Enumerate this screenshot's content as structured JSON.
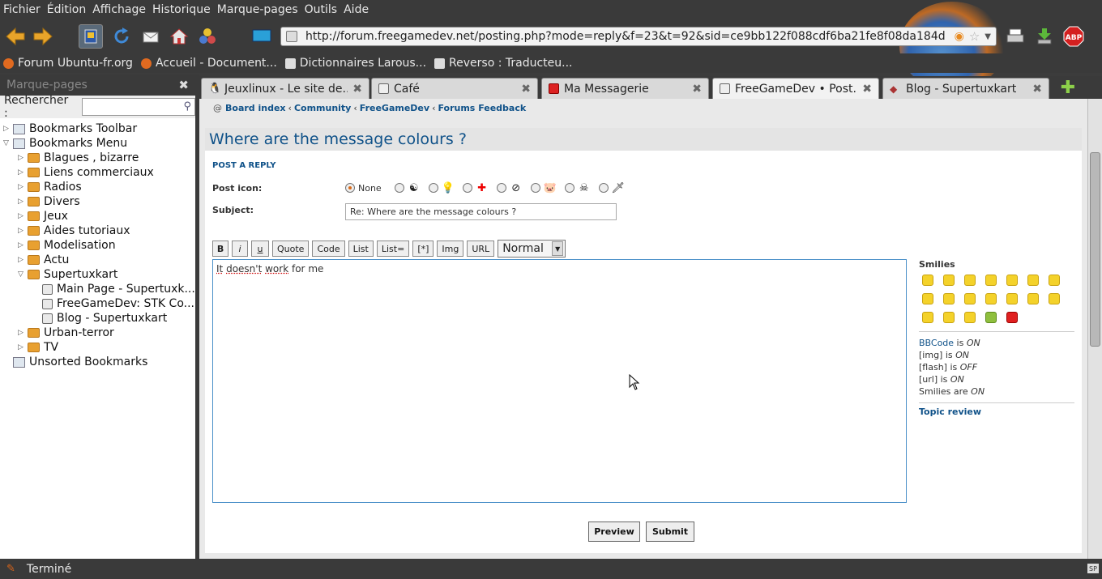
{
  "menubar": {
    "items": [
      "Fichier",
      "Édition",
      "Affichage",
      "Historique",
      "Marque-pages",
      "Outils",
      "Aide"
    ]
  },
  "navbar": {
    "url": "http://forum.freegamedev.net/posting.php?mode=reply&f=23&t=92&sid=ce9bb122f088cdf6ba21fe8f08da184d"
  },
  "bookmarks_bar": {
    "items": [
      "Forum Ubuntu-fr.org",
      "Accueil - Document...",
      "Dictionnaires Larous...",
      "Reverso : Traducteu..."
    ]
  },
  "sidebar": {
    "title": "Marque-pages",
    "search_label": "Rechercher :",
    "tree": [
      {
        "label": "Bookmarks Toolbar",
        "type": "special",
        "twisty": "▷",
        "indent": 0
      },
      {
        "label": "Bookmarks Menu",
        "type": "special",
        "twisty": "▽",
        "indent": 0
      },
      {
        "label": "Blagues , bizarre",
        "type": "folder",
        "twisty": "▷",
        "indent": 1
      },
      {
        "label": "Liens commerciaux",
        "type": "folder",
        "twisty": "▷",
        "indent": 1
      },
      {
        "label": "Radios",
        "type": "folder",
        "twisty": "▷",
        "indent": 1
      },
      {
        "label": "Divers",
        "type": "folder",
        "twisty": "▷",
        "indent": 1
      },
      {
        "label": "Jeux",
        "type": "folder",
        "twisty": "▷",
        "indent": 1
      },
      {
        "label": "Aides tutoriaux",
        "type": "folder",
        "twisty": "▷",
        "indent": 1
      },
      {
        "label": "Modelisation",
        "type": "folder",
        "twisty": "▷",
        "indent": 1
      },
      {
        "label": "Actu",
        "type": "folder",
        "twisty": "▷",
        "indent": 1
      },
      {
        "label": "Supertuxkart",
        "type": "folder",
        "twisty": "▽",
        "indent": 1
      },
      {
        "label": "Main Page - Supertuxk...",
        "type": "page",
        "twisty": "",
        "indent": 2
      },
      {
        "label": "FreeGameDev: STK Co...",
        "type": "page",
        "twisty": "",
        "indent": 2
      },
      {
        "label": "Blog - Supertuxkart",
        "type": "page",
        "twisty": "",
        "indent": 2
      },
      {
        "label": "Urban-terror",
        "type": "folder",
        "twisty": "▷",
        "indent": 1
      },
      {
        "label": "TV",
        "type": "folder",
        "twisty": "▷",
        "indent": 1
      },
      {
        "label": "Unsorted Bookmarks",
        "type": "special",
        "twisty": "",
        "indent": 0
      }
    ]
  },
  "tabs": [
    {
      "label": "Jeuxlinux - Le site de...",
      "active": false
    },
    {
      "label": "Café",
      "active": false
    },
    {
      "label": "Ma Messagerie",
      "active": false
    },
    {
      "label": "FreeGameDev • Post...",
      "active": true
    },
    {
      "label": "Blog - Supertuxkart",
      "active": false
    }
  ],
  "page": {
    "breadcrumb": [
      "Board index",
      "Community",
      "FreeGameDev",
      "Forums Feedback"
    ],
    "topic_title": "Where are the message colours ?",
    "post_reply": "POST A REPLY",
    "post_icon_label": "Post icon:",
    "post_icon_none": "None",
    "subject_label": "Subject:",
    "subject_value": "Re: Where are the message colours ?",
    "format_buttons": [
      "B",
      "i",
      "u",
      "Quote",
      "Code",
      "List",
      "List=",
      "[*]",
      "Img",
      "URL"
    ],
    "font_size": "Normal",
    "message_words": [
      "It",
      "doesn't",
      "work",
      "for",
      "me"
    ],
    "smilies_title": "Smilies",
    "bbcode": {
      "bbcode_link": "BBCode",
      "bbcode_is": " is ",
      "bbcode_state": "ON",
      "img_text": "[img] is ",
      "img_state": "ON",
      "flash_text": "[flash] is ",
      "flash_state": "OFF",
      "url_text": "[url] is ",
      "url_state": "ON",
      "smilies_text": "Smilies are ",
      "smilies_state": "ON"
    },
    "topic_review": "Topic review",
    "preview_label": "Preview",
    "submit_label": "Submit"
  },
  "statusbar": {
    "text": "Terminé",
    "right_badge": "SP"
  }
}
